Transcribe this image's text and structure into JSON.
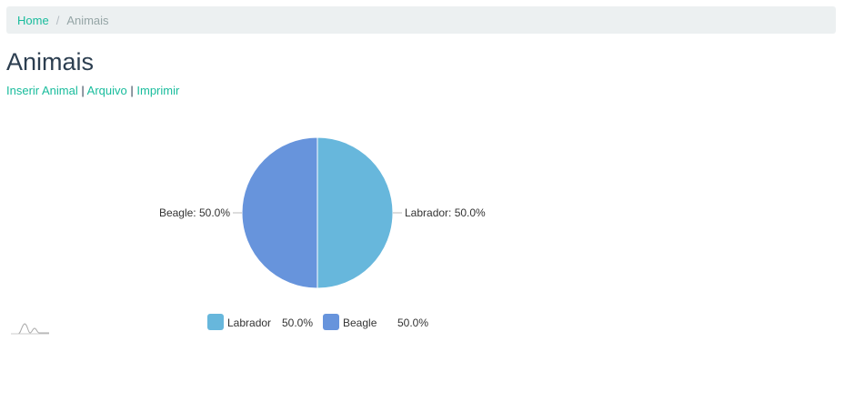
{
  "breadcrumb": {
    "home": "Home",
    "separator": "/",
    "current": "Animais"
  },
  "page": {
    "title": "Animais"
  },
  "actions": {
    "insert": "Inserir Animal",
    "archive": "Arquivo",
    "print": "Imprimir",
    "separator": "|"
  },
  "colors": {
    "accent": "#18bc9c",
    "labrador": "#67b7dc",
    "beagle": "#6794dc"
  },
  "chart_data": {
    "type": "pie",
    "categories": [
      "Labrador",
      "Beagle"
    ],
    "values": [
      50.0,
      50.0
    ],
    "labels": [
      "Labrador: 50.0%",
      "Beagle: 50.0%"
    ],
    "legend_values": [
      "50.0%",
      "50.0%"
    ],
    "legend": "bottom"
  },
  "icons": {
    "watermark": "chart-watermark-icon"
  }
}
